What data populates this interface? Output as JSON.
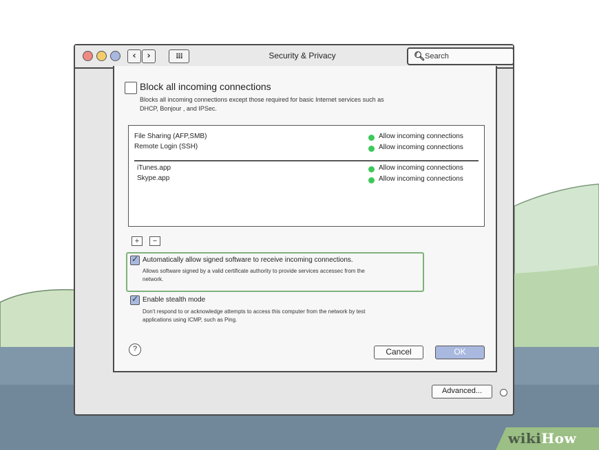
{
  "window": {
    "title": "Security & Privacy",
    "back_glyph": "‹",
    "forward_glyph": "›",
    "grid_glyph": "⁝⁝⁝",
    "search": {
      "placeholder": "Search",
      "icon": "search-icon"
    }
  },
  "firewall": {
    "block_all": {
      "label": "Block all incoming connections",
      "checked": false,
      "description_line1": "Blocks all incoming connections except those required for basic Internet services such as",
      "description_line2": "DHCP, Bonjour , and IPSec."
    },
    "services": [
      {
        "name": "File Sharing (AFP,SMB)",
        "status": "Allow incoming connections"
      },
      {
        "name": "Remote Login (SSH)",
        "status": "Allow incoming connections"
      }
    ],
    "apps": [
      {
        "name": "iTunes.app",
        "status": "Allow incoming connections"
      },
      {
        "name": "Skype.app",
        "status": "Allow incoming connections"
      }
    ],
    "add_label": "+",
    "remove_label": "−",
    "auto_allow": {
      "label": "Automatically allow signed software to receive incoming connections.",
      "checked": true,
      "description_line1": "Allows software signed by a valid certificate authority to provide services accessec from the",
      "description_line2": "network."
    },
    "stealth": {
      "label": "Enable stealth mode",
      "checked": true,
      "description_line1": "Don't respond to or acknowledge attempts to access this computer from the network by test",
      "description_line2": "applications using ICMP, such as Ping."
    },
    "help_label": "?",
    "cancel_label": "Cancel",
    "ok_label": "OK"
  },
  "advanced_label": "Advanced...",
  "watermark": {
    "wiki": "wiki",
    "how": "How"
  },
  "colors": {
    "sky": "#ffffff",
    "hills": "#cfe3c4",
    "ground": "#7f97a8",
    "allow_dot": "#3cc95a",
    "ok_button": "#a9b8de",
    "highlight_border": "#7fb27a"
  }
}
